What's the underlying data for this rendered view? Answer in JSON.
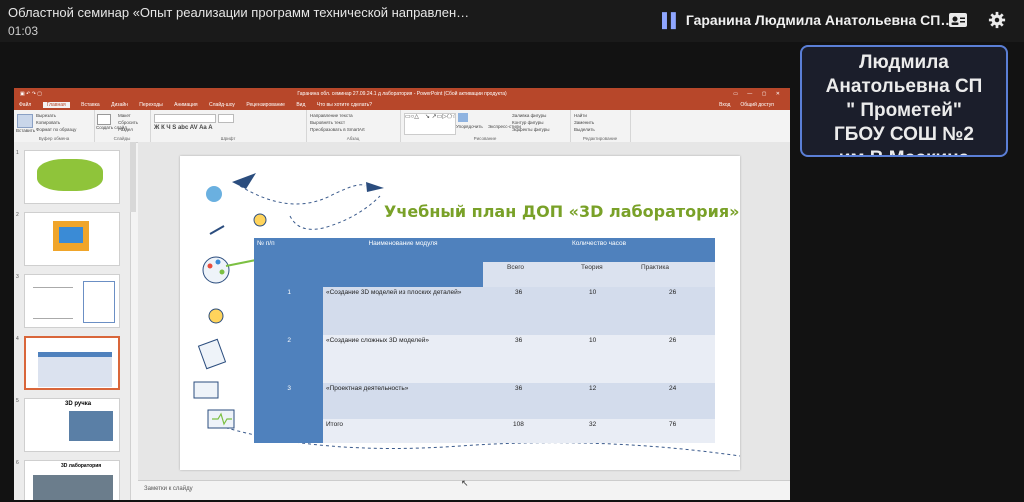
{
  "meeting": {
    "title": "Областной семинар «Опыт реализации программ технической направлен…",
    "time": "01:03",
    "speaker": "Гаранина Людмила Анатольевна СП…"
  },
  "participant_tile": {
    "lines": [
      "Людмила",
      "Анатольевна СП",
      "\" Прометей\"",
      "ГБОУ СОШ №2",
      "им.В.Маскина"
    ]
  },
  "app": {
    "window_title": "Гаранина обл. семинар 27.09.24.1 д лаборатория - PowerPoint (Сбой активации продукта)",
    "tabs": [
      "Файл",
      "Главная",
      "Вставка",
      "Дизайн",
      "Переходы",
      "Анимация",
      "Слайд-шоу",
      "Рецензирование",
      "Вид",
      "Что вы хотите сделать?"
    ],
    "account": "Вход",
    "share": "Общий доступ",
    "ribbon": {
      "clipboard": {
        "paste": "Вставить",
        "cut": "Вырезать",
        "copy": "Копировать",
        "format": "Формат по образцу",
        "label": "Буфер обмена"
      },
      "slides": {
        "new": "Создать слайд",
        "layout": "Макет",
        "reset": "Сбросить",
        "section": "Раздел",
        "label": "Слайды"
      },
      "font": {
        "label": "Шрифт"
      },
      "paragraph": {
        "direction": "Направление текста",
        "align": "Выровнять текст",
        "smartart": "Преобразовать в SmartArt",
        "label": "Абзац"
      },
      "drawing": {
        "arrange": "Упорядочить",
        "styles": "Экспресс-стили",
        "fill": "Заливка фигуры",
        "outline": "Контур фигуры",
        "effects": "Эффекты фигуры",
        "label": "Рисование"
      },
      "editing": {
        "find": "Найти",
        "replace": "Заменить",
        "select": "Выделить",
        "label": "Редактирование"
      }
    },
    "thumbnails": [
      "1",
      "2",
      "3",
      "4",
      "5",
      "6"
    ],
    "thumb5_title": "3D ручка",
    "thumb6_title": "3D лаборатория",
    "notes_placeholder": "Заметки к слайду"
  },
  "slide": {
    "title": "Учебный план ДОП «3D лаборатория»",
    "table": {
      "headers": {
        "num": "№ п/п",
        "module": "Наименование модуля",
        "hours": "Количество часов"
      },
      "subheaders": [
        "Всего",
        "Теория",
        "Практика"
      ],
      "rows": [
        {
          "num": "1",
          "module": "«Создание 3D моделей  из плоских деталей»",
          "total": "36",
          "theory": "10",
          "practice": "26"
        },
        {
          "num": "2",
          "module": "«Создание сложных 3D моделей»",
          "total": "36",
          "theory": "10",
          "practice": "26"
        },
        {
          "num": "3",
          "module": "«Проектная деятельность»",
          "total": "36",
          "theory": "12",
          "practice": "24"
        }
      ],
      "total_row": {
        "label": "Итого",
        "total": "108",
        "theory": "32",
        "practice": "76"
      }
    }
  }
}
